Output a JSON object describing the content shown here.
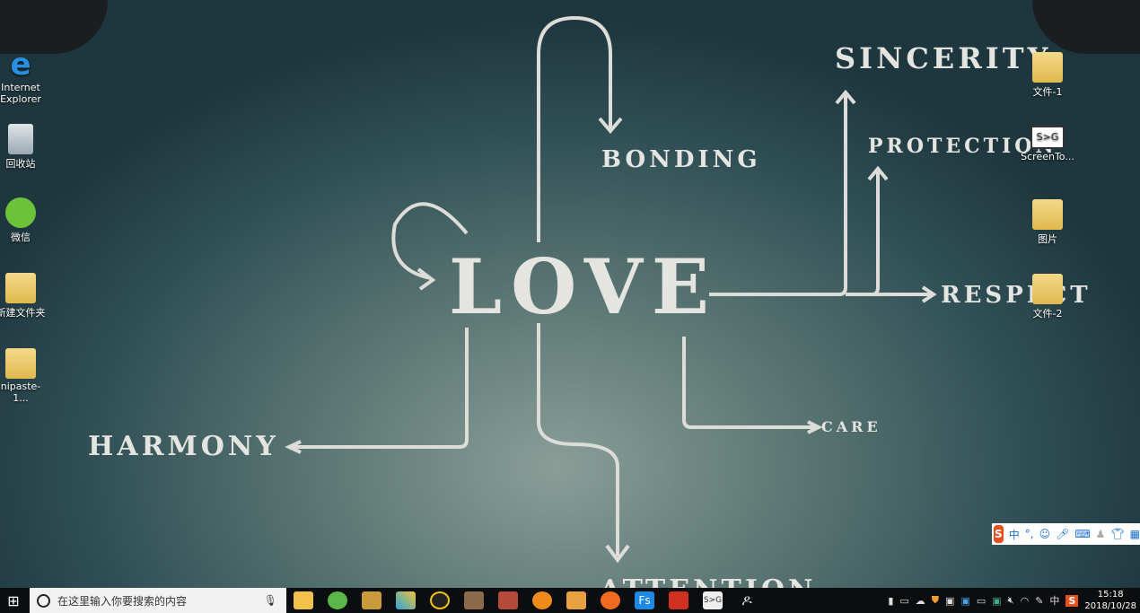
{
  "wallpaper": {
    "words": {
      "love": "LOVE",
      "bonding": "BONDING",
      "sincerity": "SINCERITY",
      "protection": "PROTECTION",
      "respect": "RESPECT",
      "care": "CARE",
      "harmony": "HARMONY",
      "attention": "ATTENTION"
    }
  },
  "desktop_left": [
    {
      "label": "Internet Explorer",
      "icon": "ie-icon"
    },
    {
      "label": "回收站",
      "icon": "recycle-bin-icon"
    },
    {
      "label": "微信",
      "icon": "wechat-icon"
    },
    {
      "label": "新建文件夹",
      "icon": "folder-icon"
    },
    {
      "label": "nipaste-1...",
      "icon": "folder-icon"
    }
  ],
  "desktop_right": [
    {
      "label": "文件-1",
      "icon": "folder-icon"
    },
    {
      "label": "ScreenTo...",
      "icon": "screentogif-icon"
    },
    {
      "label": "图片",
      "icon": "folder-icon"
    },
    {
      "label": "文件-2",
      "icon": "folder-icon"
    }
  ],
  "taskbar": {
    "search_placeholder": "在这里输入你要搜索的内容",
    "apps": [
      "file-explorer",
      "browser-e",
      "league",
      "app-x",
      "qq",
      "game",
      "game2",
      "video",
      "game3",
      "browser-g",
      "fs",
      "powerpoint",
      "screentogif",
      "people"
    ],
    "fs_label": "Fs",
    "screentogif_label": "S>G"
  },
  "tray": {
    "ime_label": "中",
    "time": "15:18",
    "date": "2018/10/28"
  },
  "ime_bar": {
    "logo": "S",
    "mode": "中",
    "punct": "°,"
  },
  "colors": {
    "taskbar": "#0b0d0f",
    "accent": "#e8501e"
  }
}
